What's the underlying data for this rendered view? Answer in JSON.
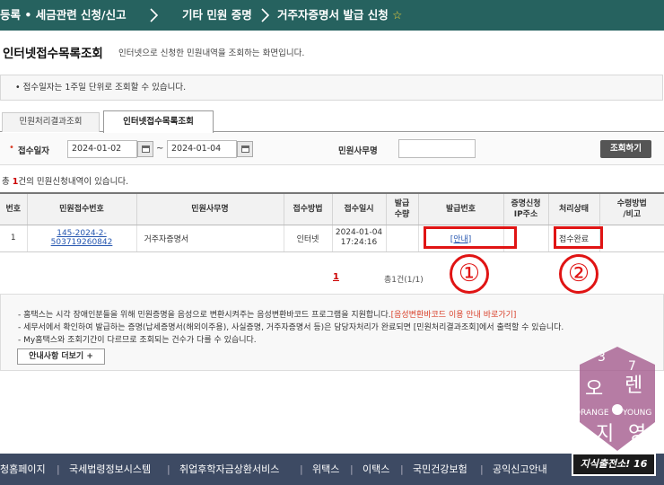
{
  "topbar": {
    "crumbs": [
      "등록 • 세금관련 신청/신고",
      "기타 민원 증명",
      "거주자증명서 발급 신청"
    ],
    "star_icon": "star-icon"
  },
  "page": {
    "title": "인터넷접수목록조회",
    "description": "인터넷으로 신청한 민원내역을 조회하는 화면입니다."
  },
  "notice": "• 접수일자는 1주일 단위로 조회할 수 있습니다.",
  "tabs": [
    {
      "label": "민원처리결과조회",
      "active": false
    },
    {
      "label": "인터넷접수목록조회",
      "active": true
    }
  ],
  "search": {
    "date_label": "접수일자",
    "start_date": "2024-01-02",
    "end_date": "2024-01-04",
    "range_sep": "~",
    "office_label": "민원사무명",
    "office_value": "",
    "button": "조회하기"
  },
  "result": {
    "prefix": "총",
    "count": "1",
    "suffix": "건의 민원신청내역이 있습니다."
  },
  "table": {
    "headers": [
      "번호",
      "민원접수번호",
      "민원사무명",
      "접수방법",
      "접수일시",
      "발급\n수량",
      "발급번호",
      "증명신청\nIP주소",
      "처리상태",
      "수령방법\n/비고"
    ],
    "rows": [
      {
        "no": "1",
        "receipt_no": "145-2024-2-503719260842",
        "office": "거주자증명서",
        "method": "인터넷",
        "date": "2024-01-04",
        "time": "17:24:16",
        "qty": "",
        "issue_no": "[안내]",
        "ip": "",
        "status": "접수완료",
        "note": ""
      }
    ]
  },
  "annotations": {
    "circle1": "①",
    "circle2": "②",
    "color": "#e01414"
  },
  "pagination": {
    "current": "1",
    "info": "총1건(1/1)"
  },
  "guide": {
    "line1": "- 홈택스는 시각 장애인분들을 위해 민원증명을 음성으로 변환시켜주는 음성변환바코드 프로그램을 지원합니다.",
    "line1_link": "[음성변환바코드 이용 안내 바로가기]",
    "line2": "- 세무서에서 확인하여 발급하는 증명(납세증명서(해외이주용), 사실증명, 거주자증명서 등)은 담당자처리가 완료되면 [민원처리결과조회]에서 출력할 수 있습니다.",
    "line3": "- My홈택스와 조회기간이 다르므로 조회되는 건수가 다를 수 있습니다.",
    "more_button": "안내사항 더보기 +"
  },
  "footer": {
    "links": [
      "청홈페이지",
      "국세법령정보시스템",
      "취업후학자금상환서비스",
      "위택스",
      "이택스",
      "국민건강보험",
      "공익신고안내"
    ]
  },
  "watermark": {
    "top": "37",
    "kor1": "오",
    "kor2": "렌",
    "kor3": "지",
    "kor4": "영",
    "eng1": "ORANGE",
    "eng2": "YOUNG",
    "badge": "지식출전소! 16"
  },
  "colors": {
    "topbar": "#26625f",
    "footer": "#3d4a63",
    "accent_red": "#e01414",
    "link_blue": "#2556b0",
    "watermark": "#a2578a"
  }
}
